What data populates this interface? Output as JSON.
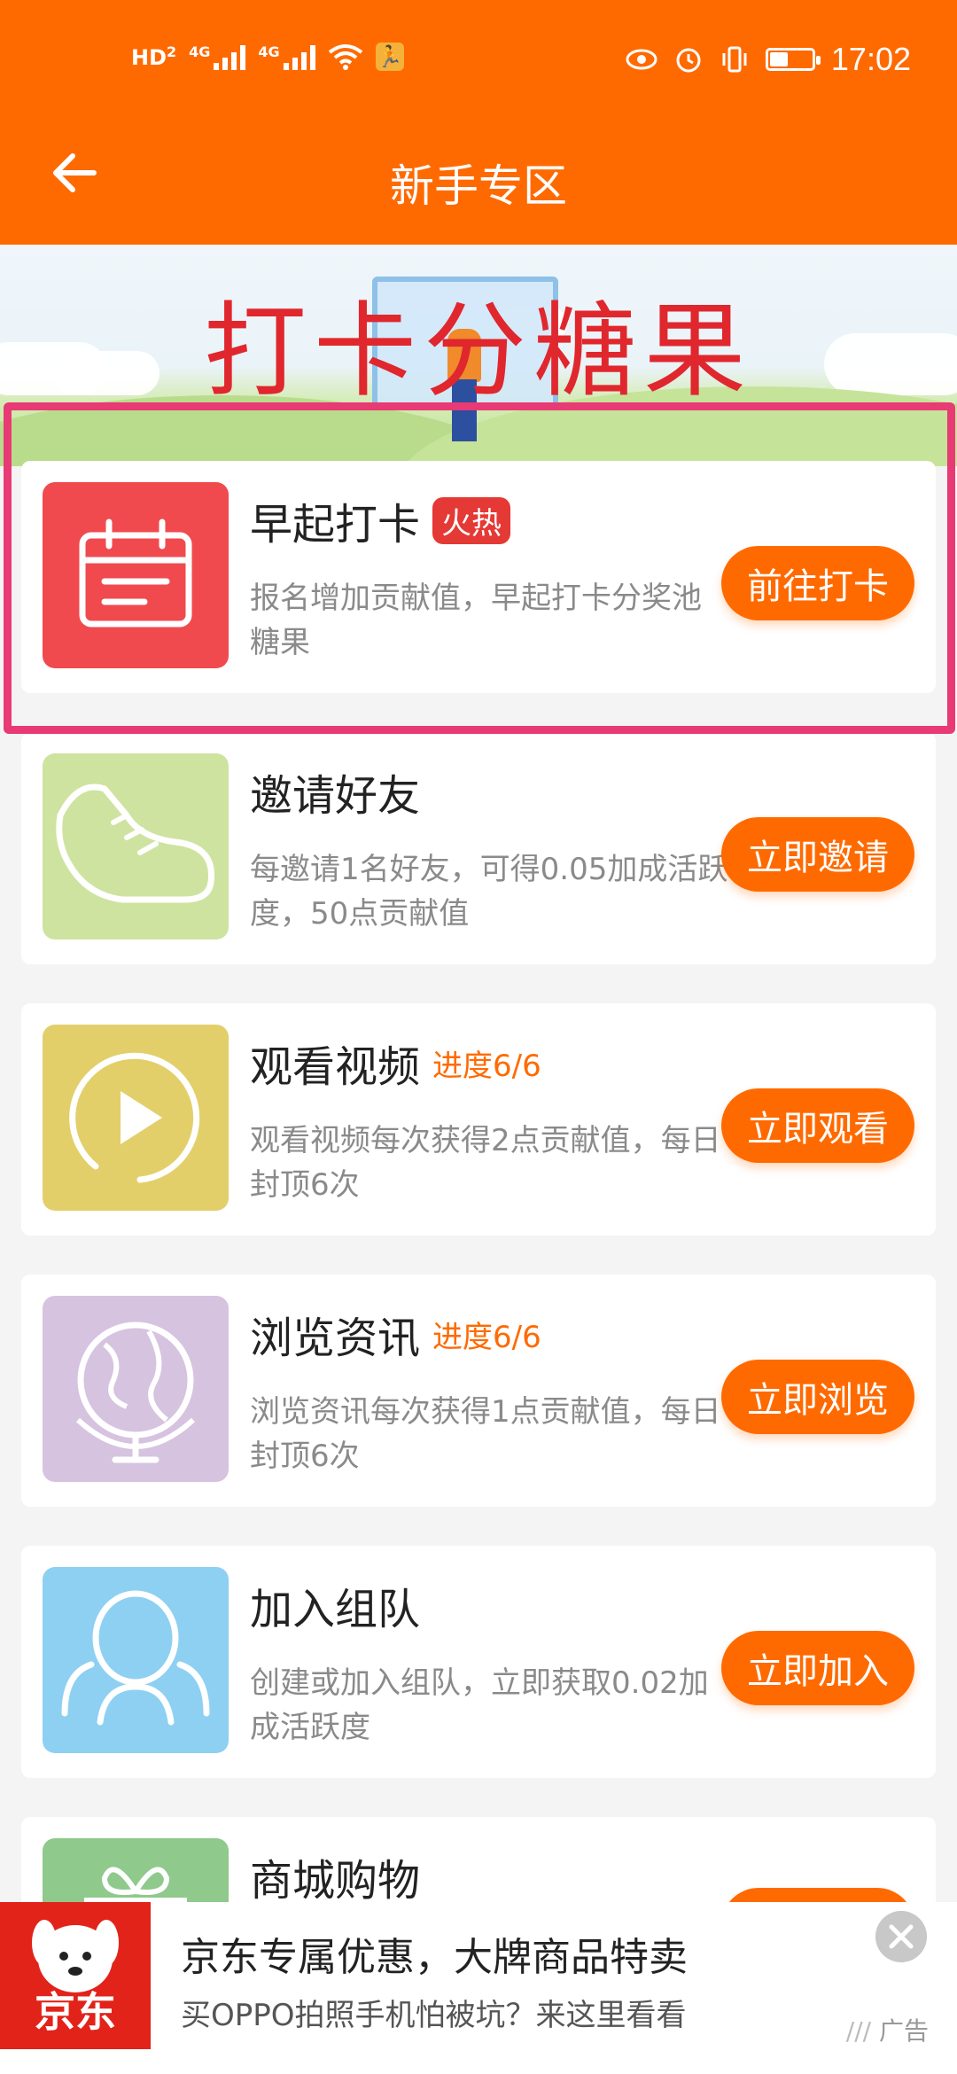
{
  "status_bar": {
    "hd_label": "HD",
    "hd_sub": "2",
    "net1": "4G",
    "net2": "4G",
    "time": "17:02",
    "colors": {
      "text": "#ffffff"
    }
  },
  "nav": {
    "title": "新手专区",
    "back_icon": "arrow-left-icon"
  },
  "banner": {
    "title": "打卡分糖果"
  },
  "tasks": [
    {
      "title": "早起打卡",
      "tag": "火热",
      "tag_type": "hot",
      "desc": "报名增加贡献值，早起打卡分奖池糖果",
      "button": "前往打卡",
      "icon": "calendar-icon",
      "icon_bg": "#f04a4f"
    },
    {
      "title": "邀请好友",
      "tag": "",
      "desc": "每邀请1名好友，可得0.05加成活跃度，50点贡献值",
      "button": "立即邀请",
      "icon": "sneaker-icon",
      "icon_bg": "#cfe3a0"
    },
    {
      "title": "观看视频",
      "tag": "进度6/6",
      "tag_type": "progress",
      "desc": "观看视频每次获得2点贡献值，每日封顶6次",
      "button": "立即观看",
      "icon": "play-circle-icon",
      "icon_bg": "#e3cf6a"
    },
    {
      "title": "浏览资讯",
      "tag": "进度6/6",
      "tag_type": "progress",
      "desc": "浏览资讯每次获得1点贡献值，每日封顶6次",
      "button": "立即浏览",
      "icon": "globe-icon",
      "icon_bg": "#d6c3df"
    },
    {
      "title": "加入组队",
      "tag": "",
      "desc": "创建或加入组队，立即获取0.02加成活跃度",
      "button": "立即加入",
      "icon": "team-icon",
      "icon_bg": "#8dd0f2"
    },
    {
      "title": "商城购物",
      "tag": "",
      "desc": "",
      "button": "",
      "icon": "gift-icon",
      "icon_bg": "#8fc98c"
    }
  ],
  "ad": {
    "logo_text": "京东",
    "title": "京东专属优惠，大牌商品特卖",
    "subtitle": "买OPPO拍照手机怕被坑？来这里看看",
    "tag": "广告"
  },
  "colors": {
    "brand_orange": "#ff6a00",
    "highlight": "#e83a74",
    "hot_tag": "#e53935",
    "banner_title": "#e0272d"
  }
}
